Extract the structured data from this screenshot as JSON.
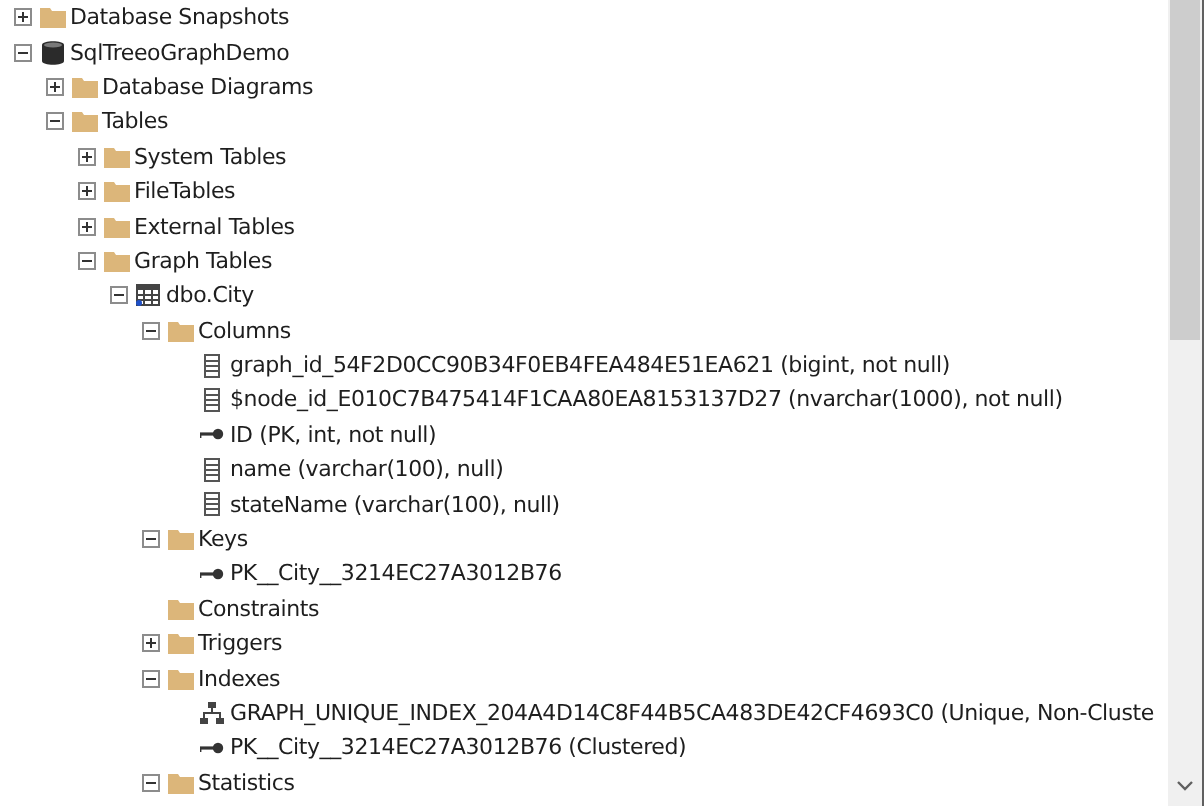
{
  "tree": [
    {
      "label": "Database Snapshots",
      "kind": "folder",
      "expanded": false
    },
    {
      "label": "SqlTreeoGraphDemo",
      "kind": "database",
      "expanded": true,
      "children": [
        {
          "label": "Database Diagrams",
          "kind": "folder",
          "expanded": false
        },
        {
          "label": "Tables",
          "kind": "folder",
          "expanded": true,
          "children": [
            {
              "label": "System Tables",
              "kind": "folder",
              "expanded": false
            },
            {
              "label": "FileTables",
              "kind": "folder",
              "expanded": false
            },
            {
              "label": "External Tables",
              "kind": "folder",
              "expanded": false
            },
            {
              "label": "Graph Tables",
              "kind": "folder",
              "expanded": true,
              "children": [
                {
                  "label": "dbo.City",
                  "kind": "table",
                  "expanded": true,
                  "children": [
                    {
                      "label": "Columns",
                      "kind": "folder",
                      "expanded": true,
                      "children": [
                        {
                          "label": "graph_id_54F2D0CC90B34F0EB4FEA484E51EA621 (bigint, not null)",
                          "kind": "column"
                        },
                        {
                          "label": "$node_id_E010C7B475414F1CAA80EA8153137D27 (nvarchar(1000), not null)",
                          "kind": "column"
                        },
                        {
                          "label": "ID (PK, int, not null)",
                          "kind": "key"
                        },
                        {
                          "label": "name (varchar(100), null)",
                          "kind": "column"
                        },
                        {
                          "label": "stateName (varchar(100), null)",
                          "kind": "column"
                        }
                      ]
                    },
                    {
                      "label": "Keys",
                      "kind": "folder",
                      "expanded": true,
                      "children": [
                        {
                          "label": "PK__City__3214EC27A3012B76",
                          "kind": "key"
                        }
                      ]
                    },
                    {
                      "label": "Constraints",
                      "kind": "folder"
                    },
                    {
                      "label": "Triggers",
                      "kind": "folder",
                      "expanded": false
                    },
                    {
                      "label": "Indexes",
                      "kind": "folder",
                      "expanded": true,
                      "children": [
                        {
                          "label": "GRAPH_UNIQUE_INDEX_204A4D14C8F44B5CA483DE42CF4693C0 (Unique, Non-Cluste",
                          "kind": "index"
                        },
                        {
                          "label": "PK__City__3214EC27A3012B76 (Clustered)",
                          "kind": "key"
                        }
                      ]
                    },
                    {
                      "label": "Statistics",
                      "kind": "folder",
                      "expanded": true
                    }
                  ]
                }
              ]
            }
          ]
        }
      ]
    }
  ]
}
